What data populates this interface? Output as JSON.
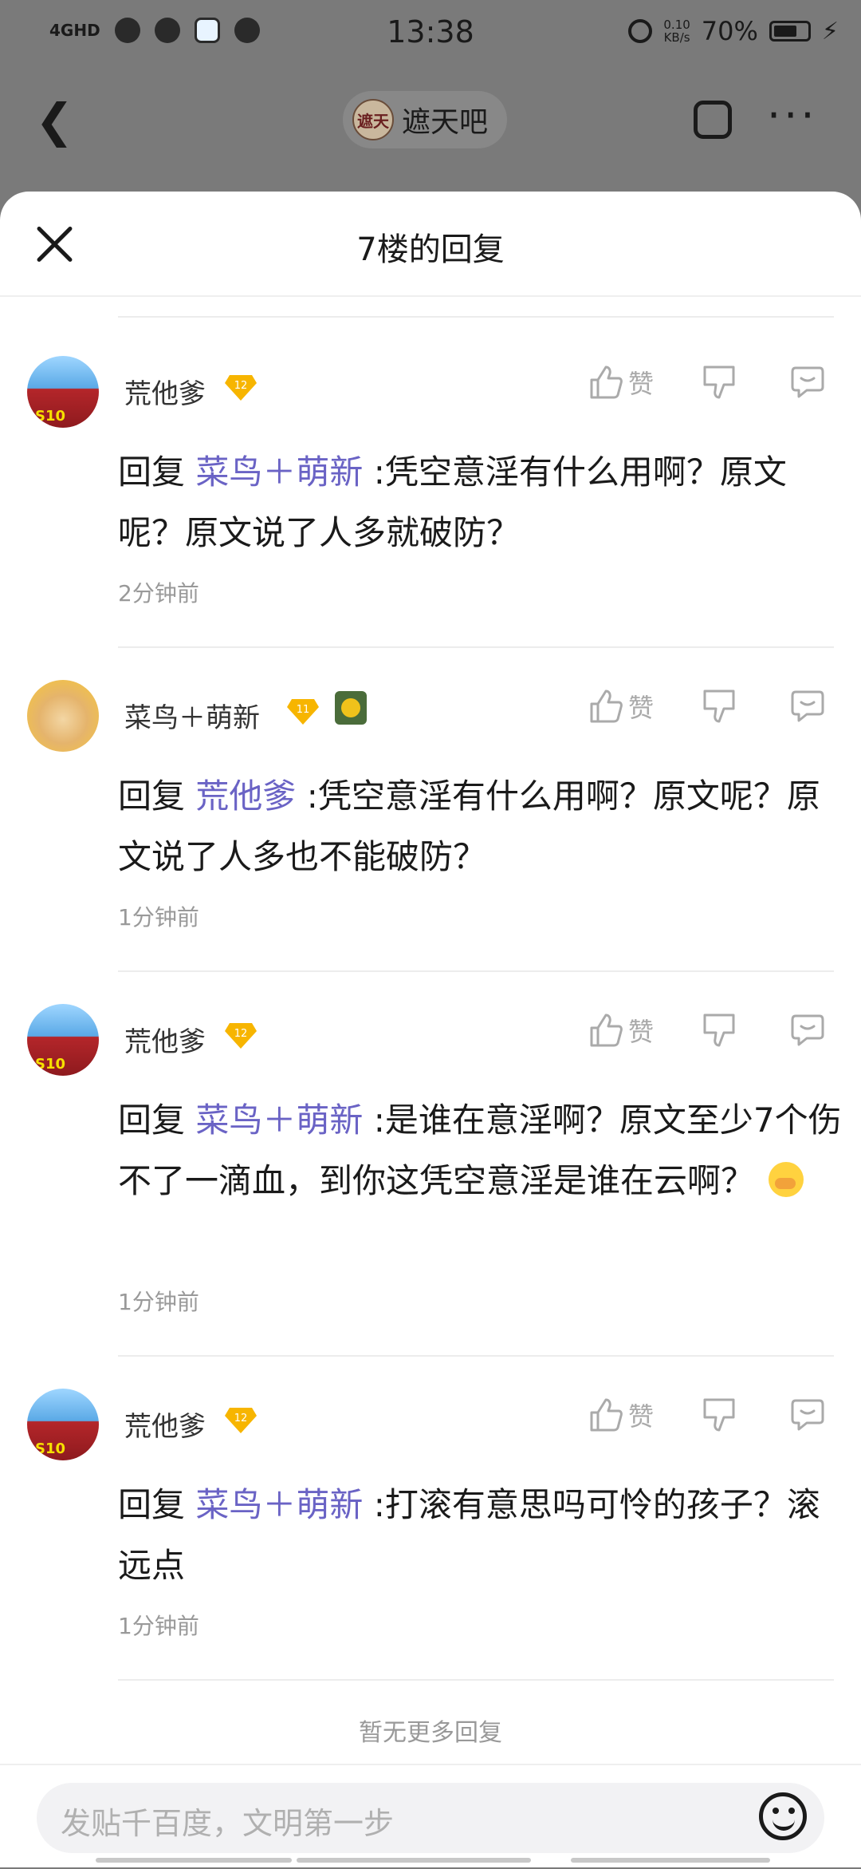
{
  "status_bar": {
    "network": "4GHD",
    "time": "13:38",
    "speed_value": "0.10",
    "speed_unit": "KB/s",
    "battery_text": "70%",
    "battery_level": 0.7
  },
  "nav": {
    "forum_name": "遮天吧",
    "forum_logo_text": "遮天"
  },
  "sheet": {
    "title": "7楼的回复",
    "like_label": "赞",
    "no_more": "暂无更多回复",
    "input_placeholder": "发贴千百度，文明第一步"
  },
  "comments": [
    {
      "username": "荒他爹",
      "level": "12",
      "avatar_badge": "S10",
      "reply_prefix": "回复",
      "mention": "菜鸟＋萌新",
      "text": ":凭空意淫有什么用啊？原文呢？原文说了人多就破防？",
      "time": "2分钟前"
    },
    {
      "username": "菜鸟＋萌新",
      "level": "11",
      "reply_prefix": "回复",
      "mention": "荒他爹",
      "text": ":凭空意淫有什么用啊？原文呢？原文说了人多也不能破防？",
      "time": "1分钟前"
    },
    {
      "username": "荒他爹",
      "level": "12",
      "avatar_badge": "S10",
      "reply_prefix": "回复",
      "mention": "菜鸟＋萌新",
      "text": ":是谁在意淫啊？原文至少7个伤不了一滴血，到你这凭空意淫是谁在云啊？",
      "time": "1分钟前"
    },
    {
      "username": "荒他爹",
      "level": "12",
      "avatar_badge": "S10",
      "reply_prefix": "回复",
      "mention": "菜鸟＋萌新",
      "text": ":打滚有意思吗可怜的孩子？滚远点",
      "time": "1分钟前"
    }
  ]
}
